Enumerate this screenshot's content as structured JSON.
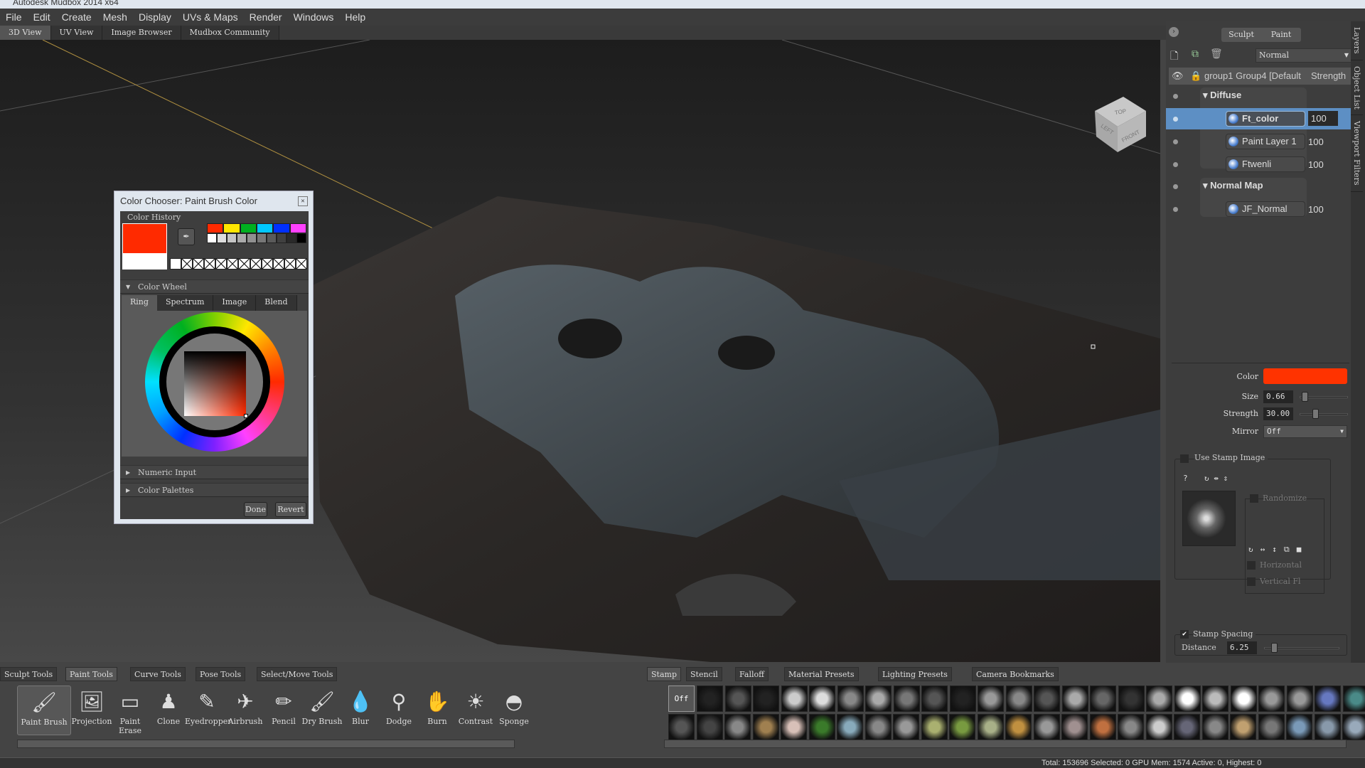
{
  "window": {
    "title": "Autodesk Mudbox 2014 x64"
  },
  "menu": [
    "File",
    "Edit",
    "Create",
    "Mesh",
    "Display",
    "UVs & Maps",
    "Render",
    "Windows",
    "Help"
  ],
  "view_tabs": [
    "3D View",
    "UV View",
    "Image Browser",
    "Mudbox Community"
  ],
  "viewcube": {
    "labels": [
      "LEFT",
      "FRONT",
      "TOP"
    ]
  },
  "color_chooser": {
    "title": "Color Chooser: Paint Brush Color",
    "history_label": "Color History",
    "current_color": "#ff2a00",
    "previous_color": "#ffffff",
    "swatches_row1": [
      "#ff2a00",
      "#ffe600",
      "#00b020",
      "#00c8ff",
      "#0030ff",
      "#ff40ff"
    ],
    "swatches_row2": [
      "#ffffff",
      "#dddddd",
      "#c4c4c4",
      "#aaaaaa",
      "#909090",
      "#777777",
      "#5a5a5a",
      "#404040",
      "#2a2a2a",
      "#000000"
    ],
    "wheel_section": "Color Wheel",
    "wheel_tabs": [
      "Ring",
      "Spectrum",
      "Image",
      "Blend"
    ],
    "numeric_section": "Numeric Input",
    "palettes_section": "Color Palettes",
    "done": "Done",
    "revert": "Revert"
  },
  "right_panel": {
    "mode_tabs": [
      "Sculpt",
      "Paint"
    ],
    "blend_mode": "Normal",
    "header": {
      "name": "group1 Group4 [Default",
      "strength": "Strength"
    },
    "groups": [
      {
        "name": "Diffuse",
        "layers": [
          {
            "name": "Ft_color",
            "strength": "100",
            "selected": true
          },
          {
            "name": "Paint Layer 1",
            "strength": "100"
          },
          {
            "name": "Ftwenli",
            "strength": "100"
          }
        ]
      },
      {
        "name": "Normal Map",
        "layers": [
          {
            "name": "JF_Normal",
            "strength": "100"
          }
        ]
      }
    ],
    "side_tabs": [
      "Layers",
      "Object List",
      "Viewport Filters"
    ],
    "props": {
      "color_label": "Color",
      "color": "#ff3300",
      "size_label": "Size",
      "size": "0.66",
      "size_slider": 0.05,
      "strength_label": "Strength",
      "strength": "30.00",
      "strength_slider": 0.3,
      "mirror_label": "Mirror",
      "mirror": "Off",
      "use_stamp": "Use Stamp Image",
      "randomize": "Randomize",
      "horizontal": "Horizontal",
      "vertical": "Vertical Fl",
      "stamp_spacing": "Stamp Spacing",
      "stamp_spacing_checked": true,
      "distance_label": "Distance",
      "distance": "6.25",
      "distance_slider": 0.1
    }
  },
  "tool_tabs": [
    "Sculpt Tools",
    "Paint Tools",
    "Curve Tools",
    "Pose Tools",
    "Select/Move Tools"
  ],
  "tools": [
    {
      "label": "Paint Brush",
      "icon": "🖌"
    },
    {
      "label": "Projection",
      "icon": "🖼"
    },
    {
      "label": "Paint Erase",
      "icon": "▭"
    },
    {
      "label": "Clone",
      "icon": "♟"
    },
    {
      "label": "Eyedropper",
      "icon": "✎"
    },
    {
      "label": "Airbrush",
      "icon": "✈"
    },
    {
      "label": "Pencil",
      "icon": "✏"
    },
    {
      "label": "Dry Brush",
      "icon": "🖌"
    },
    {
      "label": "Blur",
      "icon": "💧"
    },
    {
      "label": "Dodge",
      "icon": "⚲"
    },
    {
      "label": "Burn",
      "icon": "✋"
    },
    {
      "label": "Contrast",
      "icon": "☀"
    },
    {
      "label": "Sponge",
      "icon": "◓"
    }
  ],
  "tray_tabs": [
    "Stamp",
    "Stencil",
    "Falloff",
    "Material Presets",
    "Lighting Presets",
    "Camera Bookmarks"
  ],
  "stamp_off": "Off",
  "stamps_row1": [
    "#222",
    "#555",
    "#222",
    "#ccc",
    "#ddd",
    "#888",
    "#aaa",
    "#777",
    "#555",
    "#222",
    "#999",
    "#888",
    "#555",
    "#aaa",
    "#666",
    "#333",
    "#aaa",
    "#fff",
    "#bbb",
    "#fff",
    "#999",
    "#999",
    "#6678c0",
    "#4a8a88"
  ],
  "stamps_row2": [
    "#555",
    "#444",
    "#888",
    "#a08050",
    "#d8c0b8",
    "#3a7a2a",
    "#8ab",
    "#888",
    "#999",
    "#aab070",
    "#789a40",
    "#a8b088",
    "#c09040",
    "#999",
    "#a09090",
    "#c07040",
    "#888",
    "#ccc",
    "#667",
    "#888",
    "#c0a070",
    "#777",
    "#7a9ab8",
    "#89a",
    "#9ab"
  ],
  "status": "Total: 153696  Selected: 0 GPU Mem: 1574  Active: 0, Highest: 0"
}
